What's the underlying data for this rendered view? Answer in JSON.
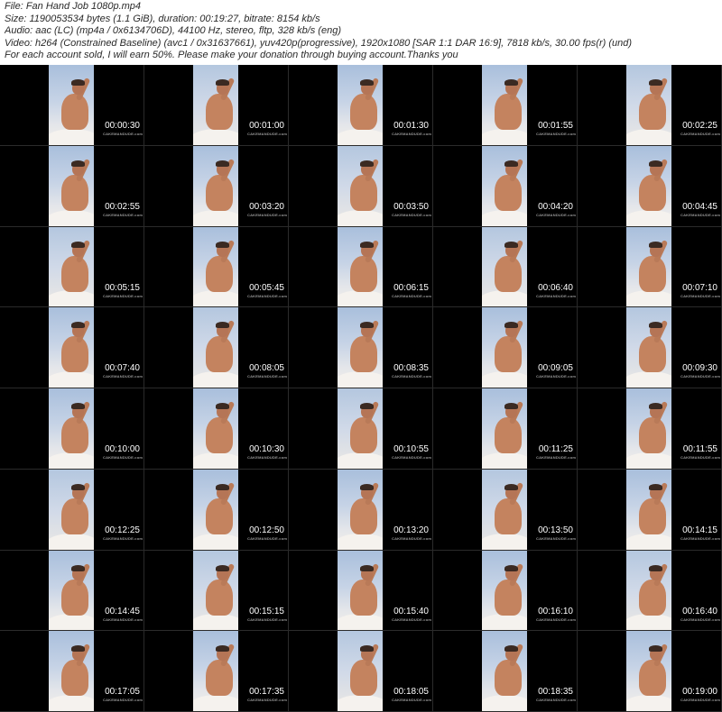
{
  "header": {
    "file": "File: Fan Hand Job 1080p.mp4",
    "size": "Size: 1190053534 bytes (1.1 GiB), duration: 00:19:27, bitrate: 8154 kb/s",
    "audio": "Audio: aac (LC) (mp4a / 0x6134706D), 44100 Hz, stereo, fltp, 328 kb/s (eng)",
    "video": "Video: h264 (Constrained Baseline) (avc1 / 0x31637661), yuv420p(progressive), 1920x1080 [SAR 1:1 DAR 16:9], 7818 kb/s, 30.00 fps(r) (und)",
    "note": "For each account sold, I will earn 50%. Please make your donation through buying account.Thanks you"
  },
  "watermark": "CAKEMANDUDE.com",
  "timestamps": [
    "00:00:30",
    "00:01:00",
    "00:01:30",
    "00:01:55",
    "00:02:25",
    "00:02:55",
    "00:03:20",
    "00:03:50",
    "00:04:20",
    "00:04:45",
    "00:05:15",
    "00:05:45",
    "00:06:15",
    "00:06:40",
    "00:07:10",
    "00:07:40",
    "00:08:05",
    "00:08:35",
    "00:09:05",
    "00:09:30",
    "00:10:00",
    "00:10:30",
    "00:10:55",
    "00:11:25",
    "00:11:55",
    "00:12:25",
    "00:12:50",
    "00:13:20",
    "00:13:50",
    "00:14:15",
    "00:14:45",
    "00:15:15",
    "00:15:40",
    "00:16:10",
    "00:16:40",
    "00:17:05",
    "00:17:35",
    "00:18:05",
    "00:18:35",
    "00:19:00"
  ]
}
